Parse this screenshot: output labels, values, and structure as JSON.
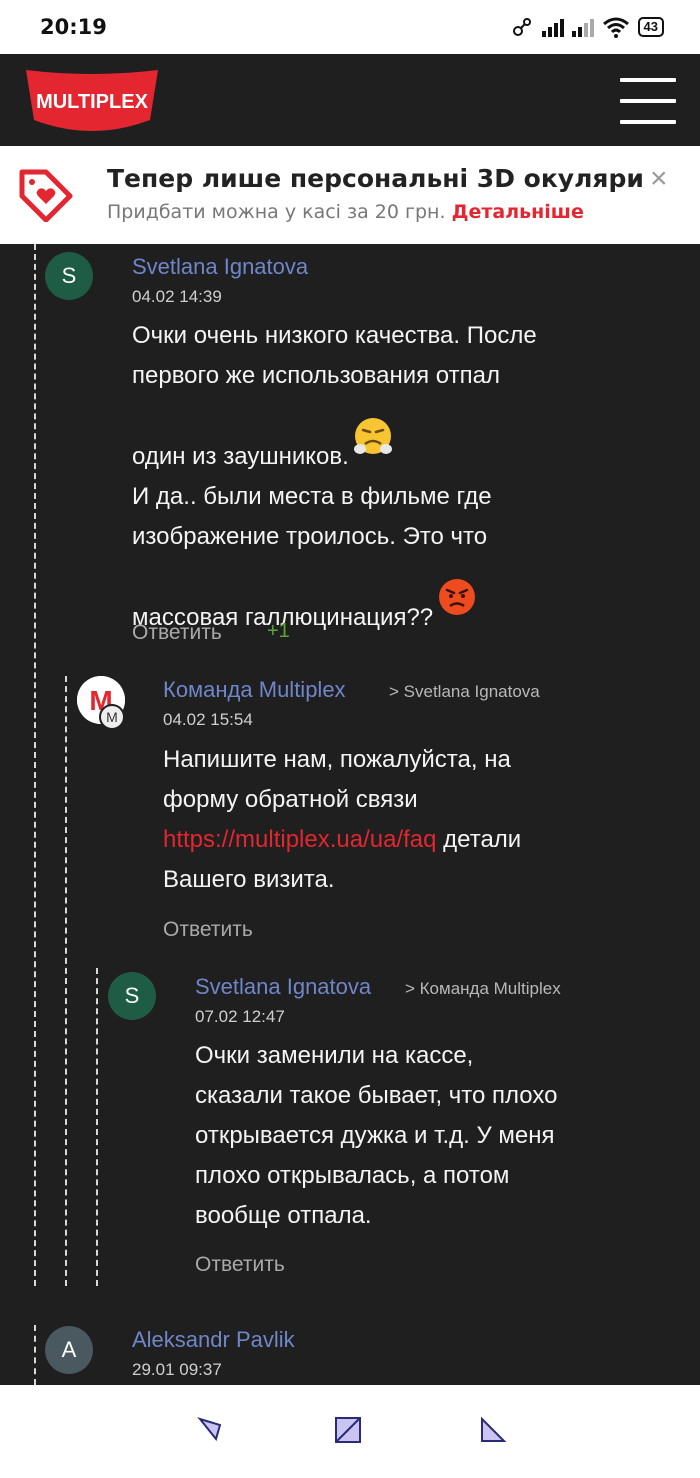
{
  "status_bar": {
    "time": "20:19",
    "battery": "43"
  },
  "header": {
    "logo_text": "MULTIPLEX",
    "brand_color": "#e3262f"
  },
  "banner": {
    "title": "Тепер лише персональні 3D окуляри",
    "subtitle": "Придбати можна у касі за 20 грн.",
    "link": "Детальніше",
    "close": "×"
  },
  "comments": [
    {
      "avatar": "S",
      "author": "Svetlana Ignatova",
      "date": "04.02 14:39",
      "text_lines": [
        "Очки очень низкого качества. После",
        "первого же использования отпал",
        "один из заушников.",
        "И да.. были места в фильме где",
        "изображение троилось. Это что",
        "массовая галлюцинация??"
      ],
      "emojis": [
        "steam-from-nose-emoji",
        "angry-face-emoji"
      ],
      "reply_label": "Ответить",
      "likes": "+1"
    },
    {
      "avatar": "M",
      "avatar_badge": "M",
      "author": "Команда Multiplex",
      "reply_to": "> Svetlana Ignatova",
      "date": "04.02 15:54",
      "text_lines": [
        "Напишите нам, пожалуйста, на",
        "форму обратной связи"
      ],
      "link": "https://multiplex.ua/ua/faq",
      "text_after_link": " детали",
      "text_last": "Вашего визита.",
      "reply_label": "Ответить"
    },
    {
      "avatar": "S",
      "author": "Svetlana Ignatova",
      "reply_to": "> Команда Multiplex",
      "date": "07.02 12:47",
      "text_lines": [
        "Очки заменили на кассе,",
        "сказали такое бывает, что плохо",
        "открывается дужка и т.д. У меня",
        "плохо открывалась, а потом",
        "вообще отпала."
      ],
      "reply_label": "Ответить"
    },
    {
      "avatar": "A",
      "author": "Aleksandr Pavlik",
      "date": "29.01 09:37"
    }
  ],
  "bottom_nav": [
    "nav-back",
    "nav-home",
    "nav-recents"
  ]
}
